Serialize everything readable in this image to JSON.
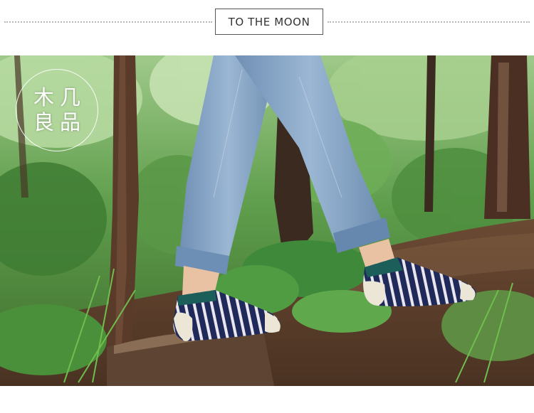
{
  "header": {
    "title": "TO THE MOON"
  },
  "logo": {
    "chars": [
      "木",
      "几",
      "良",
      "品"
    ]
  },
  "icons": {
    "logo_seal": "circular-brand-seal"
  },
  "colors": {
    "sock_teal": "#1c5e5a",
    "sock_navy": "#1f2a5a",
    "sock_cream": "#ece6d6",
    "jeans": "#7d9ec0",
    "foliage": "#3f8a3a"
  }
}
